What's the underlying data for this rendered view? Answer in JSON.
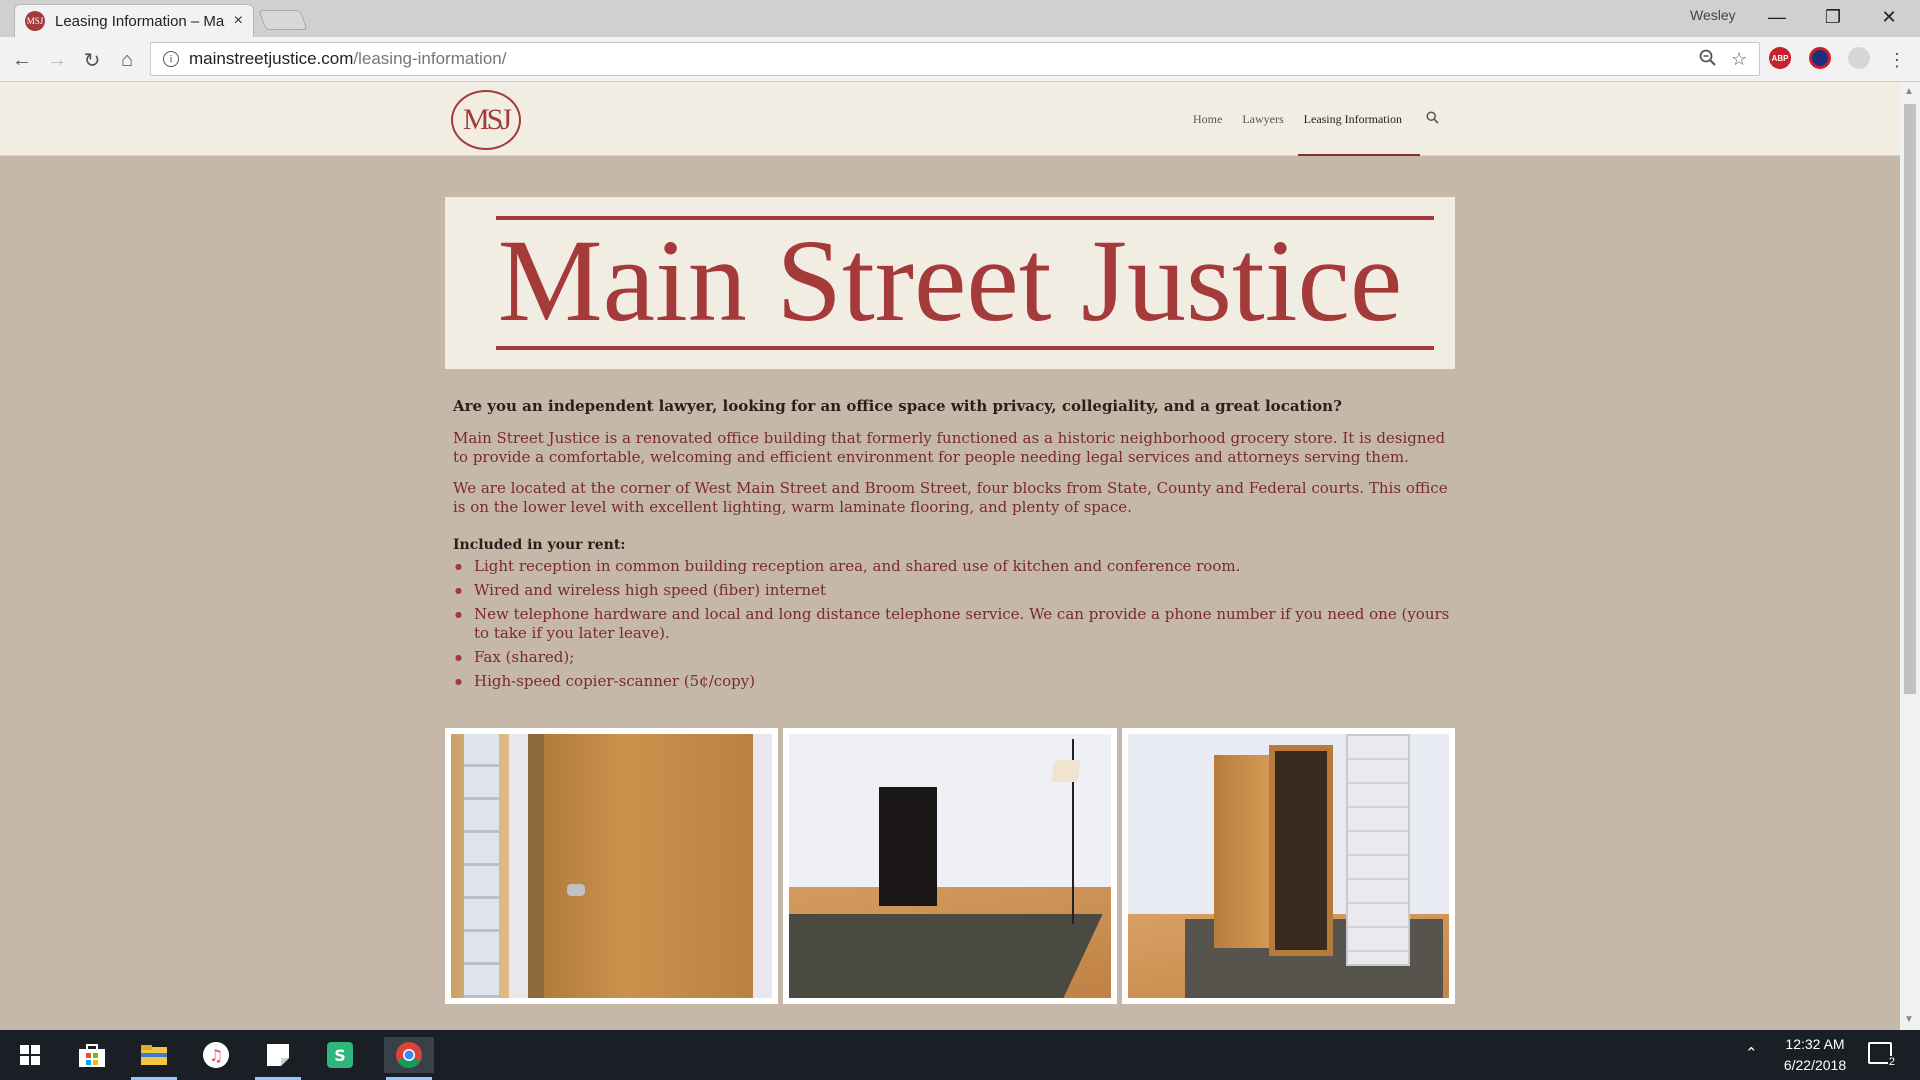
{
  "browser": {
    "tab_title": "Leasing Information – Ma",
    "tab_close": "×",
    "profile_name": "Wesley",
    "url_host": "mainstreetjustice.com",
    "url_path": "/leasing-information/",
    "ext_abp": "ABP"
  },
  "site": {
    "logo_text": "MSJ",
    "nav": [
      "Home",
      "Lawyers",
      "Leasing Information"
    ],
    "banner_title": "Main Street Justice",
    "intro_question": "Are you an independent lawyer, looking for an office space with privacy, collegiality, and a great location?",
    "paragraph_1": "Main Street Justice is a renovated office building that formerly functioned as a historic neighborhood grocery store.  It is designed to provide a comfortable, welcoming and efficient environment for people needing legal services and attorneys serving them.",
    "paragraph_2": "We are located at the corner of West Main Street and Broom Street, four blocks from State, County and Federal courts. This office is on the lower level with excellent lighting, warm laminate flooring, and plenty of space.",
    "included_label": "Included in your rent:",
    "rent_items": [
      "Light reception in common building reception area, and shared use of kitchen and conference room.",
      "Wired and wireless high speed (fiber) internet",
      "New telephone hardware and local and long distance telephone service. We can provide a phone number if you need one (yours to take if you later leave).",
      "Fax (shared);",
      "High-speed copier-scanner (5¢/copy)"
    ]
  },
  "taskbar": {
    "time": "12:32 AM",
    "date": "6/22/2018",
    "notification_count": "2"
  },
  "colors": {
    "brand_red": "#a53a3a",
    "page_bg": "#c5b8a8",
    "header_bg": "#f2ede3",
    "text_red": "#7a2a2a"
  }
}
